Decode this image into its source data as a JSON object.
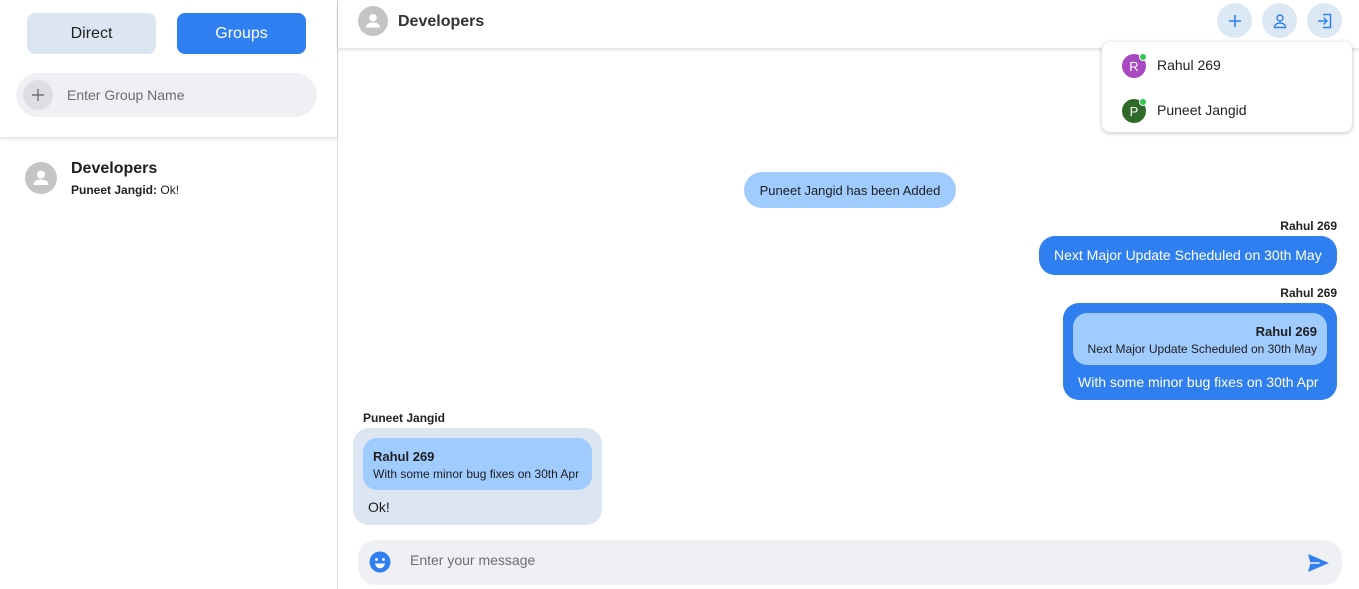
{
  "sidebar": {
    "tabs": {
      "direct": "Direct",
      "groups": "Groups"
    },
    "group_input": {
      "placeholder": "Enter Group Name",
      "value": ""
    },
    "conversations": [
      {
        "name": "Developers",
        "last_sender": "Puneet Jangid:",
        "last_message": "Ok!"
      }
    ]
  },
  "header": {
    "title": "Developers",
    "icons": [
      "plus-icon",
      "user-icon",
      "exit-icon"
    ]
  },
  "members": [
    {
      "initial": "R",
      "name": "Rahul 269",
      "color": "#a74ac0",
      "online": true
    },
    {
      "initial": "P",
      "name": "Puneet Jangid",
      "color": "#2f6a2a",
      "online": true
    }
  ],
  "messages": {
    "system": "Puneet Jangid has been Added",
    "m1": {
      "sender": "Rahul 269",
      "text": "Next Major Update Scheduled on 30th May"
    },
    "m2": {
      "sender": "Rahul 269",
      "quote_sender": "Rahul 269",
      "quote_text": "Next Major Update Scheduled on 30th May",
      "text": "With some minor bug fixes on 30th Apr"
    },
    "m3": {
      "sender": "Puneet Jangid",
      "quote_sender": "Rahul 269",
      "quote_text": "With some minor bug fixes on 30th Apr",
      "text": "Ok!"
    }
  },
  "composer": {
    "placeholder": "Enter your message",
    "value": ""
  },
  "colors": {
    "accent": "#2f7ff0",
    "accent_light": "#9fcbff",
    "incoming_bubble": "#dce6f2",
    "online": "#2ec84f"
  }
}
